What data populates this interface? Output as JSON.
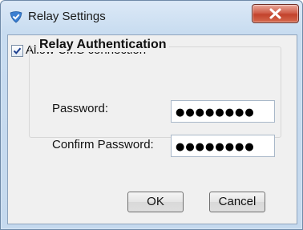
{
  "window": {
    "title": "Relay Settings",
    "icon": "check-shield-icon",
    "close_glyph": "X"
  },
  "allow_cms": {
    "label": "Allow CMS connection",
    "checked": true
  },
  "relay_auth": {
    "group_title": "Relay Authentication",
    "password_label": "Password:",
    "password_value": "●●●●●●●●",
    "confirm_label": "Confirm Password:",
    "confirm_value": "●●●●●●●●"
  },
  "buttons": {
    "ok": "OK",
    "cancel": "Cancel"
  },
  "colors": {
    "close_button": "#c2432c",
    "app_icon": "#3b7fd1"
  }
}
